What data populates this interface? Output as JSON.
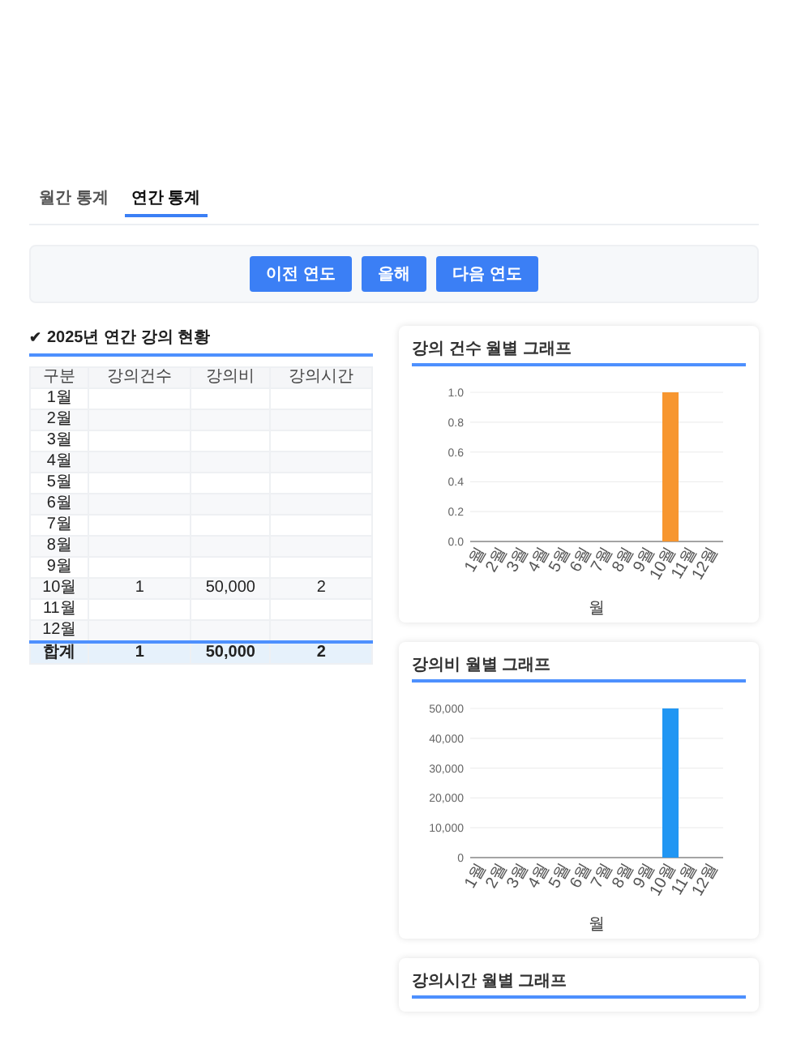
{
  "tabs": [
    {
      "label": "월간 통계",
      "selected": false
    },
    {
      "label": "연간 통계",
      "selected": true
    }
  ],
  "year_buttons": [
    "이전 연도",
    "올해",
    "다음 연도"
  ],
  "table": {
    "title": "2025년 연간 강의 현황",
    "title_icon": "✔",
    "columns": [
      "구분",
      "강의건수",
      "강의비",
      "강의시간"
    ],
    "rows": [
      {
        "label": "1월"
      },
      {
        "label": "2월"
      },
      {
        "label": "3월"
      },
      {
        "label": "4월"
      },
      {
        "label": "5월"
      },
      {
        "label": "6월"
      },
      {
        "label": "7월"
      },
      {
        "label": "8월"
      },
      {
        "label": "9월"
      },
      {
        "label": "10월",
        "count": "1",
        "fee": "50,000",
        "hours": "2"
      },
      {
        "label": "11월"
      },
      {
        "label": "12월"
      }
    ],
    "total": {
      "label": "합계",
      "count": "1",
      "fee": "50,000",
      "hours": "2"
    }
  },
  "charts": [
    {
      "title": "강의 건수 월별 그래프",
      "chart_data": {
        "type": "bar",
        "xlabel": "월",
        "categories": [
          "1월",
          "2월",
          "3월",
          "4월",
          "5월",
          "6월",
          "7월",
          "8월",
          "9월",
          "10월",
          "11월",
          "12월"
        ],
        "series": [
          {
            "color": "#f7962f",
            "values": [
              0,
              0,
              0,
              0,
              0,
              0,
              0,
              0,
              0,
              1,
              0,
              0
            ]
          }
        ],
        "ylim": [
          0,
          1
        ],
        "grid": true,
        "yticks": [
          {
            "value": 0,
            "label": "0.0"
          },
          {
            "value": 0.2,
            "label": "0.2"
          },
          {
            "value": 0.4,
            "label": "0.4"
          },
          {
            "value": 0.6,
            "label": "0.6"
          },
          {
            "value": 0.8,
            "label": "0.8"
          },
          {
            "value": 1,
            "label": "1.0"
          }
        ]
      }
    },
    {
      "title": "강의비 월별 그래프",
      "chart_data": {
        "type": "bar",
        "xlabel": "월",
        "categories": [
          "1월",
          "2월",
          "3월",
          "4월",
          "5월",
          "6월",
          "7월",
          "8월",
          "9월",
          "10월",
          "11월",
          "12월"
        ],
        "series": [
          {
            "color": "#2196f3",
            "values": [
              0,
              0,
              0,
              0,
              0,
              0,
              0,
              0,
              0,
              50000,
              0,
              0
            ]
          }
        ],
        "ylim": [
          0,
          50000
        ],
        "grid": true,
        "yticks": [
          {
            "value": 0,
            "label": "0"
          },
          {
            "value": 10000,
            "label": "10,000"
          },
          {
            "value": 20000,
            "label": "20,000"
          },
          {
            "value": 30000,
            "label": "30,000"
          },
          {
            "value": 40000,
            "label": "40,000"
          },
          {
            "value": 50000,
            "label": "50,000"
          }
        ]
      }
    },
    {
      "title": "강의시간 월별 그래프"
    }
  ]
}
